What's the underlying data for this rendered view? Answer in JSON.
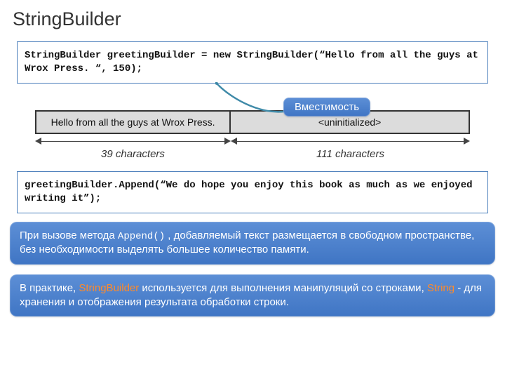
{
  "title": "StringBuilder",
  "code1": "StringBuilder greetingBuilder = new StringBuilder(“Hello from all the guys at Wrox Press. “, 150);",
  "capacity_label": "Вместимость",
  "buffer": {
    "left_text": "Hello from all the guys at Wrox Press.",
    "right_text": "<uninitialized>",
    "left_count": "39 characters",
    "right_count": "111 characters"
  },
  "code2": "greetingBuilder.Append(“We do hope you enjoy this book as much as we enjoyed writing it”);",
  "info1": {
    "prefix": "При вызове метода ",
    "mono": "Append()",
    "rest": " , добавляемый текст размещается в свободном пространстве, без необходимости выделять большее количество памяти."
  },
  "info2": {
    "p1a": "В практике, ",
    "p1b": "StringBuilder",
    "p1c": " используется для выполнения манипуляций со строками, ",
    "p2a": "String",
    "p2b": "  - для хранения и отображения результата обработки строки."
  }
}
